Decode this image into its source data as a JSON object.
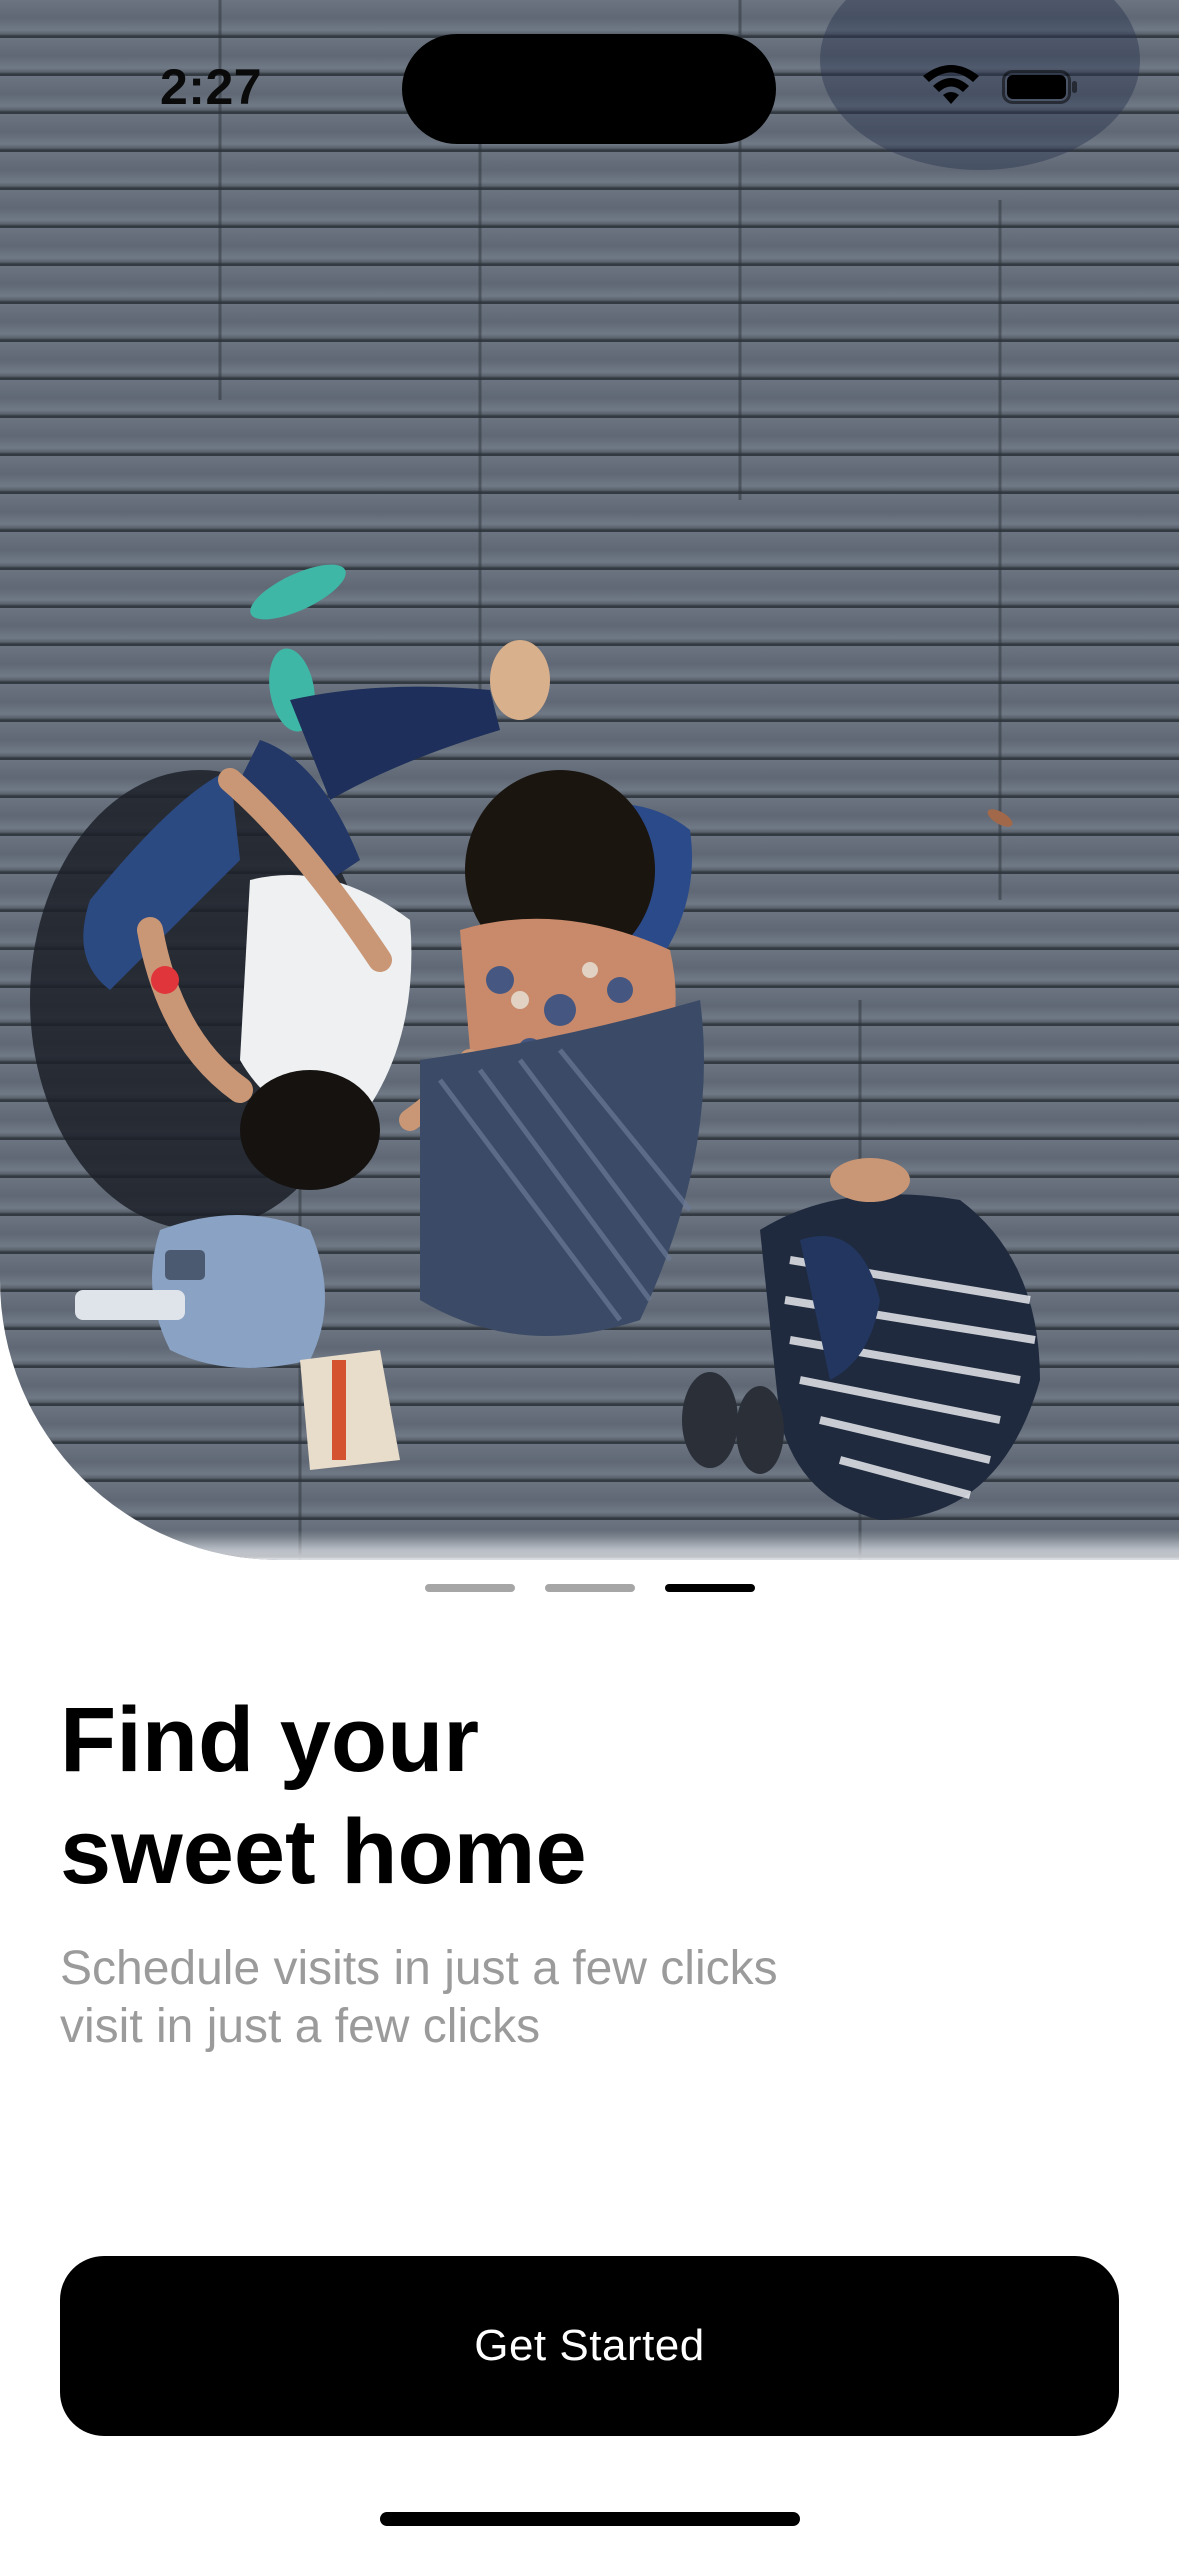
{
  "status_bar": {
    "time": "2:27",
    "icons": [
      "wifi-icon",
      "battery-icon"
    ]
  },
  "hero": {
    "image_subject": "people sitting on wooden boardwalk"
  },
  "pager": {
    "pages": 3,
    "active_index": 2
  },
  "onboarding": {
    "title_lines": [
      "Find your",
      "sweet home"
    ],
    "subtitle_lines": [
      "Schedule visits in just a few clicks",
      "visit in just a few clicks"
    ]
  },
  "actions": {
    "get_started_label": "Get Started"
  },
  "colors": {
    "primary": "#000000",
    "subtitle": "#9b9b9b",
    "pager_inactive": "#a6a6a6",
    "background": "#ffffff"
  }
}
